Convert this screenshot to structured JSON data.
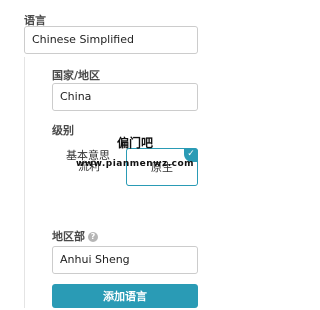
{
  "language": {
    "label": "语言",
    "value": "Chinese Simplified"
  },
  "country": {
    "label": "国家/地区",
    "value": "China"
  },
  "level": {
    "label": "级别",
    "options": [
      "基本意思",
      "中级",
      "流利",
      "原生"
    ],
    "selected": "原生"
  },
  "region": {
    "label": "地区部",
    "value": "Anhui Sheng",
    "help_icon": "?"
  },
  "watermark": {
    "title": "偏门吧",
    "url": "www.pianmenwz.com"
  },
  "add_button": "添加语言",
  "colors": {
    "accent": "#2a9bb5",
    "border": "#cccccc"
  }
}
